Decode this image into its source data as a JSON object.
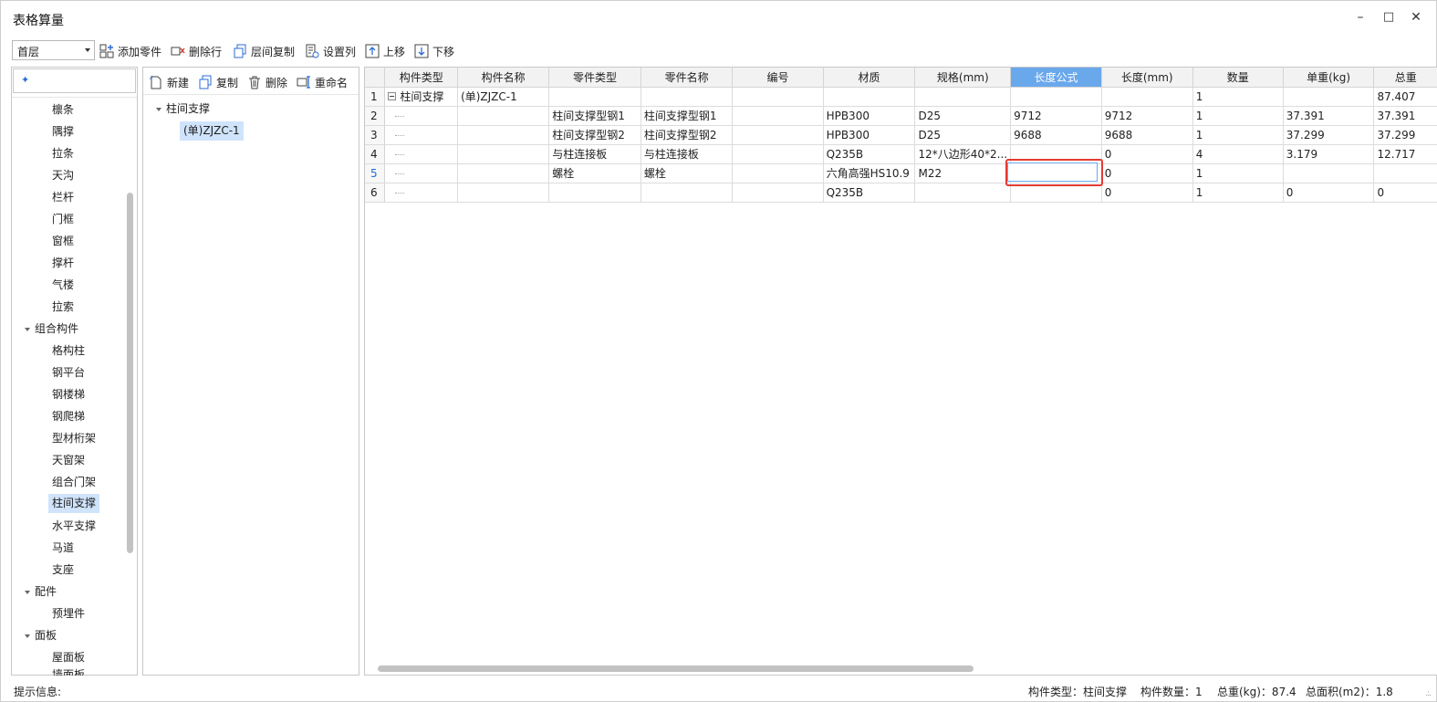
{
  "window": {
    "title": "表格算量"
  },
  "toolbar": {
    "floor": "首层",
    "add_part": "添加零件",
    "delete_row": "删除行",
    "copy_floor": "层间复制",
    "set_columns": "设置列",
    "move_up": "上移",
    "move_down": "下移"
  },
  "left_tree": {
    "items": [
      {
        "label": "檩条"
      },
      {
        "label": "隅撑"
      },
      {
        "label": "拉条"
      },
      {
        "label": "天沟"
      },
      {
        "label": "栏杆"
      },
      {
        "label": "门框"
      },
      {
        "label": "窗框"
      },
      {
        "label": "撑杆"
      },
      {
        "label": "气楼"
      },
      {
        "label": "拉索"
      },
      {
        "label": "组合构件"
      },
      {
        "label": "格构柱"
      },
      {
        "label": "钢平台"
      },
      {
        "label": "钢楼梯"
      },
      {
        "label": "钢爬梯"
      },
      {
        "label": "型材桁架"
      },
      {
        "label": "天窗架"
      },
      {
        "label": "组合门架"
      },
      {
        "label": "柱间支撑"
      },
      {
        "label": "水平支撑"
      },
      {
        "label": "马道"
      },
      {
        "label": "支座"
      },
      {
        "label": "配件"
      },
      {
        "label": "预埋件"
      },
      {
        "label": "面板"
      },
      {
        "label": "屋面板"
      },
      {
        "label": "墙面板"
      }
    ]
  },
  "mid_panel": {
    "new": "新建",
    "copy": "复制",
    "delete": "删除",
    "rename": "重命名",
    "tree_root": "柱间支撑",
    "tree_child": "(单)ZJZC-1"
  },
  "grid": {
    "headers": [
      "构件类型",
      "构件名称",
      "零件类型",
      "零件名称",
      "编号",
      "材质",
      "规格(mm)",
      "长度公式",
      "长度(mm)",
      "数量",
      "单重(kg)",
      "总重"
    ],
    "rows": [
      {
        "num": "1",
        "cells": [
          "柱间支撑",
          "(单)ZJZC-1",
          "",
          "",
          "",
          "",
          "",
          "",
          "",
          "1",
          "",
          "87.407"
        ]
      },
      {
        "num": "2",
        "cells": [
          "",
          "",
          "柱间支撑型钢1",
          "柱间支撑型钢1",
          "",
          "HPB300",
          "D25",
          "9712",
          "9712",
          "1",
          "37.391",
          "37.391"
        ]
      },
      {
        "num": "3",
        "cells": [
          "",
          "",
          "柱间支撑型钢2",
          "柱间支撑型钢2",
          "",
          "HPB300",
          "D25",
          "9688",
          "9688",
          "1",
          "37.299",
          "37.299"
        ]
      },
      {
        "num": "4",
        "cells": [
          "",
          "",
          "与柱连接板",
          "与柱连接板",
          "",
          "Q235B",
          "12*八边形40*2...",
          "",
          "0",
          "4",
          "3.179",
          "12.717"
        ]
      },
      {
        "num": "5",
        "cells": [
          "",
          "",
          "螺栓",
          "螺栓",
          "",
          "六角高强HS10.9",
          "M22",
          "",
          "0",
          "1",
          "",
          ""
        ]
      },
      {
        "num": "6",
        "cells": [
          "",
          "",
          "",
          "",
          "",
          "Q235B",
          "",
          "",
          "0",
          "1",
          "0",
          "0"
        ]
      }
    ]
  },
  "status": {
    "hint": "提示信息:",
    "type": "构件类型：柱间支撑",
    "count": "构件数量：1",
    "weight": "总重(kg)：87.4",
    "area": "总面积(m2)：1.8"
  }
}
